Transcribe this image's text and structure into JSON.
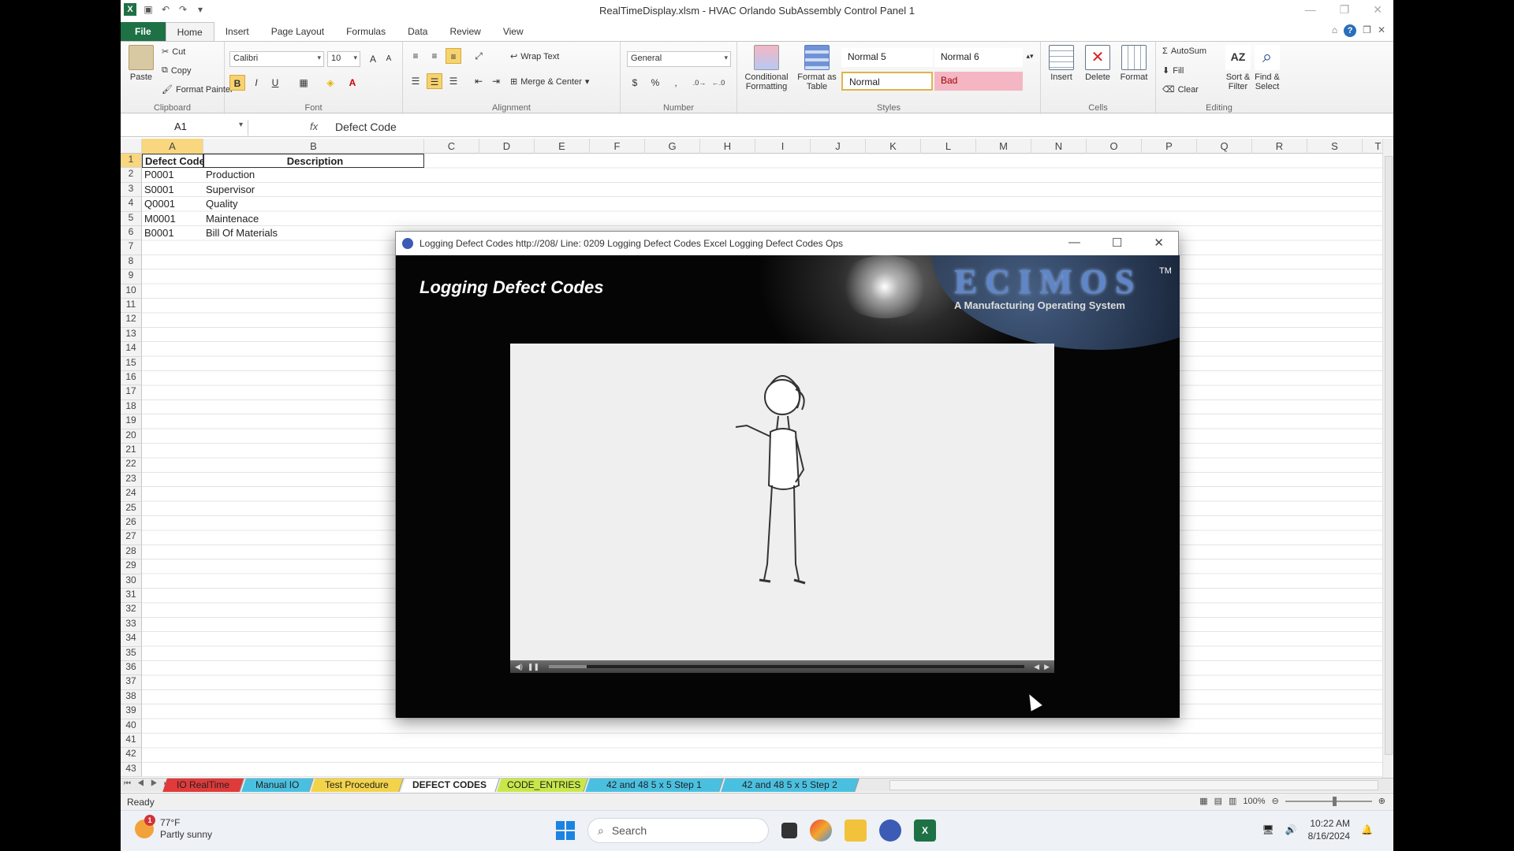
{
  "window": {
    "title": "RealTimeDisplay.xlsm  -  HVAC Orlando SubAssembly Control Panel 1"
  },
  "ribbon_tabs": [
    "File",
    "Home",
    "Insert",
    "Page Layout",
    "Formulas",
    "Data",
    "Review",
    "View"
  ],
  "ribbon": {
    "clipboard": {
      "label": "Clipboard",
      "paste": "Paste",
      "cut": "Cut",
      "copy": "Copy",
      "format_painter": "Format Painter"
    },
    "font": {
      "label": "Font",
      "name": "Calibri",
      "size": "10",
      "bold": "B",
      "italic": "I",
      "underline": "U"
    },
    "alignment": {
      "label": "Alignment",
      "wrap_text": "Wrap Text",
      "merge_center": "Merge & Center"
    },
    "number": {
      "label": "Number",
      "format": "General",
      "currency": "$",
      "percent": "%",
      "comma": ","
    },
    "styles": {
      "label": "Styles",
      "conditional": "Conditional Formatting",
      "format_table": "Format as Table",
      "normal5": "Normal 5",
      "normal6": "Normal 6",
      "normal": "Normal",
      "bad": "Bad"
    },
    "cells": {
      "label": "Cells",
      "insert": "Insert",
      "delete": "Delete",
      "format": "Format"
    },
    "editing": {
      "label": "Editing",
      "autosum": "AutoSum",
      "fill": "Fill",
      "clear": "Clear",
      "sort_filter": "Sort & Filter",
      "find_select": "Find & Select"
    }
  },
  "formula_bar": {
    "name_box": "A1",
    "fx": "fx",
    "content": "Defect Code"
  },
  "columns": [
    "A",
    "B",
    "C",
    "D",
    "E",
    "F",
    "G",
    "H",
    "I",
    "J",
    "K",
    "L",
    "M",
    "N",
    "O",
    "P",
    "Q",
    "R",
    "S",
    "T"
  ],
  "rows": [
    "1",
    "2",
    "3",
    "4",
    "5",
    "6",
    "7",
    "8",
    "9",
    "10",
    "11",
    "12",
    "13",
    "14",
    "15",
    "16",
    "17",
    "18",
    "19",
    "20",
    "21",
    "22",
    "23",
    "24",
    "25",
    "26",
    "27",
    "28",
    "29",
    "30",
    "31",
    "32",
    "33",
    "34",
    "35",
    "36",
    "37",
    "38",
    "39",
    "40",
    "41",
    "42",
    "43"
  ],
  "sheet": {
    "headers": {
      "a": "Defect Code",
      "b": "Description"
    },
    "data": [
      {
        "code": "P0001",
        "desc": "Production"
      },
      {
        "code": "S0001",
        "desc": "Supervisor"
      },
      {
        "code": "Q0001",
        "desc": "Quality"
      },
      {
        "code": "M0001",
        "desc": "Maintenace"
      },
      {
        "code": "B0001",
        "desc": "Bill Of Materials"
      }
    ]
  },
  "sheet_tabs": [
    {
      "label": "IO RealTime",
      "color": "#e03a3a"
    },
    {
      "label": "Manual IO",
      "color": "#4ac0e0"
    },
    {
      "label": "Test Procedure",
      "color": "#f2d34a"
    },
    {
      "label": "DEFECT CODES",
      "color": "#ffffff"
    },
    {
      "label": "CODE_ENTRIES",
      "color": "#c8e84a"
    },
    {
      "label": "42 and 48 5 x 5 Step 1",
      "color": "#4ac0e0"
    },
    {
      "label": "42 and 48 5 x 5 Step 2",
      "color": "#4ac0e0"
    }
  ],
  "status": {
    "ready": "Ready",
    "zoom": "100%"
  },
  "popup": {
    "title": "Logging Defect Codes http://208/ Line: 0209 Logging Defect Codes Excel Logging Defect Codes Ops",
    "heading": "Logging Defect Codes",
    "brand": "ECIMOS",
    "brand_tm": "TM",
    "tagline": "A Manufacturing Operating System"
  },
  "taskbar": {
    "temp": "77°F",
    "weather": "Partly sunny",
    "weather_badge": "1",
    "search_placeholder": "Search",
    "time": "10:22 AM",
    "date": "8/16/2024"
  },
  "colors": {
    "excel_green": "#1e7145",
    "selection": "#f9d77e",
    "bad_style": "#f4b6c2"
  }
}
